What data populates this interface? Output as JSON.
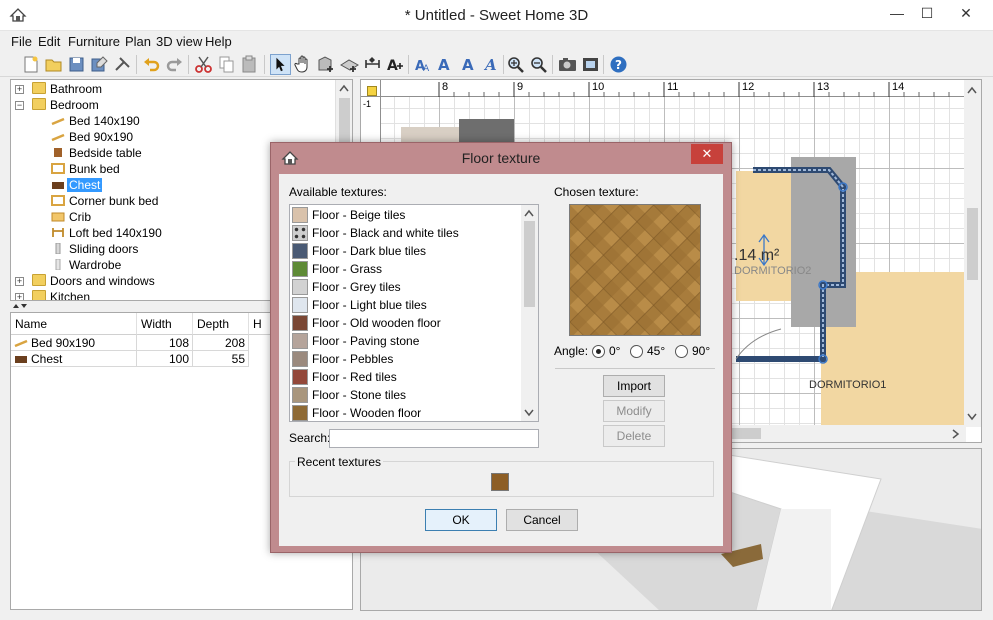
{
  "window": {
    "title": "* Untitled - Sweet Home 3D",
    "min_glyph": "—",
    "max_glyph": "☐",
    "close_glyph": "✕"
  },
  "menu": [
    "File",
    "Edit",
    "Furniture",
    "Plan",
    "3D view",
    "Help"
  ],
  "toolbar": {
    "buttons": [
      "new-icon",
      "open-icon",
      "save-icon",
      "save-as-icon",
      "preferences-icon",
      "undo-icon",
      "redo-icon",
      "cut-icon",
      "copy-icon",
      "paste-icon",
      "add-furniture-icon",
      "select-icon",
      "pan-icon",
      "create-walls-icon",
      "create-rooms-icon",
      "create-dimensions-icon",
      "add-text-icon",
      "text-style-a1-icon",
      "text-style-a2-icon",
      "text-style-a3-icon",
      "text-style-a4-icon",
      "zoom-in-icon",
      "zoom-out-icon",
      "create-photo-icon",
      "create-video-icon",
      "help-icon"
    ],
    "pressed": "select-icon"
  },
  "catalog": {
    "items": [
      {
        "label": "Bathroom",
        "level": 0,
        "type": "folder",
        "expander": "+"
      },
      {
        "label": "Bedroom",
        "level": 0,
        "type": "folder",
        "expander": "−"
      },
      {
        "label": "Bed 140x190",
        "level": 1,
        "type": "item"
      },
      {
        "label": "Bed 90x190",
        "level": 1,
        "type": "item"
      },
      {
        "label": "Bedside table",
        "level": 1,
        "type": "item"
      },
      {
        "label": "Bunk bed",
        "level": 1,
        "type": "item"
      },
      {
        "label": "Chest",
        "level": 1,
        "type": "item",
        "selected": true
      },
      {
        "label": "Corner bunk bed",
        "level": 1,
        "type": "item"
      },
      {
        "label": "Crib",
        "level": 1,
        "type": "item"
      },
      {
        "label": "Loft bed 140x190",
        "level": 1,
        "type": "item"
      },
      {
        "label": "Sliding doors",
        "level": 1,
        "type": "item"
      },
      {
        "label": "Wardrobe",
        "level": 1,
        "type": "item"
      },
      {
        "label": "Doors and windows",
        "level": 0,
        "type": "folder",
        "expander": "+"
      },
      {
        "label": "Kitchen",
        "level": 0,
        "type": "folder",
        "expander": "+"
      }
    ]
  },
  "furniture_table": {
    "columns": [
      "Name",
      "Width",
      "Depth",
      "H"
    ],
    "rows": [
      {
        "name": "Bed 90x190",
        "width": "108",
        "depth": "208"
      },
      {
        "name": "Chest",
        "width": "100",
        "depth": "55"
      }
    ]
  },
  "plan": {
    "ruler_top": [
      "8",
      "9",
      "10",
      "11",
      "12",
      "13",
      "14"
    ],
    "ruler_left": [
      "-1"
    ],
    "room_area": ".14 m²",
    "room_name_faint": "DORMITORIO2",
    "room_name": "DORMITORIO1",
    "colors": {
      "wall": "#2e4a72",
      "floor": "#f2d7a2",
      "selection": "#3c78c8"
    }
  },
  "dialog": {
    "title": "Floor texture",
    "close_glyph": "✕",
    "available_label": "Available textures:",
    "chosen_label": "Chosen texture:",
    "textures": [
      {
        "name": "Floor - Beige tiles",
        "color": "#d9c2ab"
      },
      {
        "name": "Floor - Black and white tiles",
        "color": "#cfcfcf"
      },
      {
        "name": "Floor - Dark blue tiles",
        "color": "#4a5a74"
      },
      {
        "name": "Floor - Grass",
        "color": "#5e8a36"
      },
      {
        "name": "Floor - Grey tiles",
        "color": "#d2d2d2"
      },
      {
        "name": "Floor - Light blue tiles",
        "color": "#dfe6ee"
      },
      {
        "name": "Floor - Old wooden floor",
        "color": "#7a4734"
      },
      {
        "name": "Floor - Paving stone",
        "color": "#b5a49b"
      },
      {
        "name": "Floor - Pebbles",
        "color": "#9b8a7e"
      },
      {
        "name": "Floor - Red tiles",
        "color": "#93483a"
      },
      {
        "name": "Floor - Stone tiles",
        "color": "#a9967d"
      },
      {
        "name": "Floor - Wooden floor",
        "color": "#8e6a35"
      }
    ],
    "angle_label": "Angle:",
    "angles": [
      {
        "label": "0°",
        "checked": true
      },
      {
        "label": "45°",
        "checked": false
      },
      {
        "label": "90°",
        "checked": false
      }
    ],
    "import_label": "Import",
    "modify_label": "Modify",
    "delete_label": "Delete",
    "search_label": "Search:",
    "search_value": "",
    "recent_label": "Recent textures",
    "ok_label": "OK",
    "cancel_label": "Cancel"
  }
}
